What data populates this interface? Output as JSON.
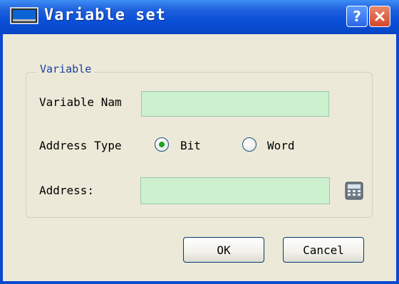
{
  "window": {
    "title": "Variable set"
  },
  "titlebar": {
    "help_label": "?",
    "close_icon": "close-icon",
    "app_icon": "window-icon"
  },
  "group": {
    "title": "Variable"
  },
  "fields": {
    "variable_name_label": "Variable Nam",
    "variable_name_value": "",
    "address_type_label": "Address Type",
    "address_label": "Address:",
    "address_value": ""
  },
  "address_type": {
    "options": [
      "Bit",
      "Word"
    ],
    "selected": "Bit"
  },
  "buttons": {
    "ok": "OK",
    "cancel": "Cancel",
    "calculator_icon": "calculator-icon"
  },
  "colors": {
    "field_bg": "#cdf0cf",
    "title_bar": "#0a50d8",
    "radio_selected": "#21a121",
    "group_title": "#1c3ea5"
  }
}
